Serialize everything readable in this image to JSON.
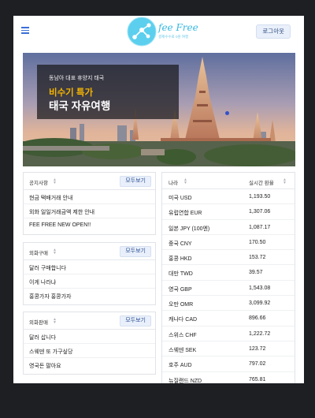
{
  "header": {
    "logo_text": "fee Free",
    "logo_sub": "결제수수료 0원 여행",
    "logout_label": "로그아웃"
  },
  "banner": {
    "small_text": "동남아 대표 휴양지 태국",
    "accent_text": "비수기 특가",
    "title_text": "태국 자유여행"
  },
  "notice": {
    "title": "공지사항",
    "more_label": "모두보기",
    "items": [
      "현금 택배거래 안내",
      "외화 일일거래금액 제한 안내",
      "FEE FREE NEW OPEN!!"
    ]
  },
  "buy": {
    "title": "외화구매",
    "more_label": "모두보기",
    "items": [
      "달러 구매합니다",
      "이게 나라냐",
      "홍콩가자 홍콩가자"
    ]
  },
  "sell": {
    "title": "외화판매",
    "more_label": "모두보기",
    "items": [
      "달러 삽니다",
      "스웨덴 또 가구싶당",
      "영국돈 팔아요"
    ]
  },
  "rates": {
    "col_country": "나라",
    "col_rate": "실시간 환율",
    "rows": [
      {
        "country": "미국 USD",
        "rate": "1,193.50"
      },
      {
        "country": "유럽연합 EUR",
        "rate": "1,307.06"
      },
      {
        "country": "일본 JPY (100엔)",
        "rate": "1,087.17"
      },
      {
        "country": "중국 CNY",
        "rate": "170.50"
      },
      {
        "country": "홍콩 HKD",
        "rate": "153.72"
      },
      {
        "country": "대만 TWD",
        "rate": "39.57"
      },
      {
        "country": "영국 GBP",
        "rate": "1,543.08"
      },
      {
        "country": "오만 OMR",
        "rate": "3,099.92"
      },
      {
        "country": "캐나다 CAD",
        "rate": "896.66"
      },
      {
        "country": "스위스 CHF",
        "rate": "1,222.72"
      },
      {
        "country": "스웨덴 SEK",
        "rate": "123.72"
      },
      {
        "country": "호주 AUD",
        "rate": "797.02"
      },
      {
        "country": "뉴질랜드 NZD",
        "rate": "765.81"
      }
    ]
  },
  "colors": {
    "accent": "#f4b400",
    "brand": "#37b8e0",
    "button_bg": "#e9f0fb",
    "button_text": "#2d4f92"
  }
}
